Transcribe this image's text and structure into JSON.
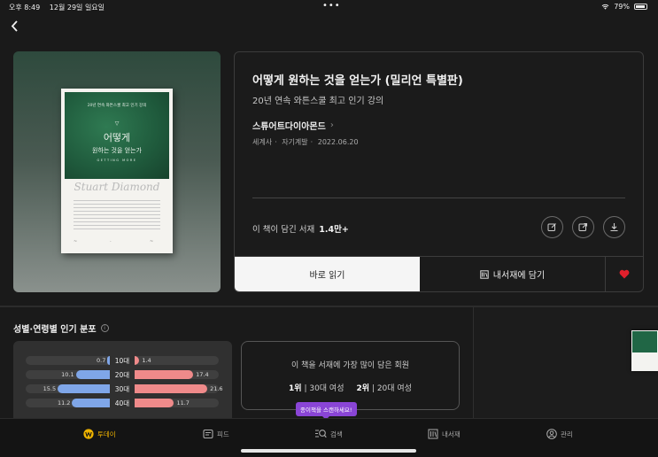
{
  "status_bar": {
    "time": "오후 8:49",
    "date": "12월 29일 일요일",
    "battery": "79%"
  },
  "book": {
    "title": "어떻게 원하는 것을 얻는가 (밀리언 특별판)",
    "subtitle": "20년 연속 와튼스쿨 최고 인기 강의",
    "author": "스튜어트다이아몬드",
    "publisher": "세계사",
    "category": "자기계발",
    "date": "2022.06.20",
    "shelf_label": "이 책이 담긴 서재",
    "shelf_count": "1.4만+",
    "cover": {
      "top_text": "20년 연속 와튼스쿨 최고 인기 강의",
      "title_line1": "어떻게",
      "title_line2": "원하는 것을 얻는가",
      "eng": "GETTING MORE",
      "author_sig": "Stuart Diamond"
    }
  },
  "actions": {
    "read": "바로 읽기",
    "add_shelf": "내서재에 담기"
  },
  "distribution": {
    "title": "성별·연령별 인기 분포",
    "rows": [
      {
        "age": "10대",
        "male": 0.7,
        "female": 1.4
      },
      {
        "age": "20대",
        "male": 10.1,
        "female": 17.4
      },
      {
        "age": "30대",
        "male": 15.5,
        "female": 21.6
      },
      {
        "age": "40대",
        "male": 11.2,
        "female": 11.7
      }
    ]
  },
  "rank": {
    "heading": "이 책을 서재에 가장 많이 담은 회원",
    "first_rank": "1위",
    "first_group": "30대 여성",
    "second_rank": "2위",
    "second_group": "20대 여성"
  },
  "tooltip": "종이책을 스캔하세요!",
  "tabs": [
    {
      "label": "투데이",
      "icon": "today-icon",
      "active": true
    },
    {
      "label": "피드",
      "icon": "feed-icon",
      "active": false
    },
    {
      "label": "검색",
      "icon": "search-icon",
      "active": false
    },
    {
      "label": "내서재",
      "icon": "library-icon",
      "active": false
    },
    {
      "label": "관리",
      "icon": "profile-icon",
      "active": false
    }
  ],
  "colors": {
    "male": "#7fa6e8",
    "female": "#ef8a8a",
    "accent": "#f0b400",
    "like": "#e0202c"
  }
}
